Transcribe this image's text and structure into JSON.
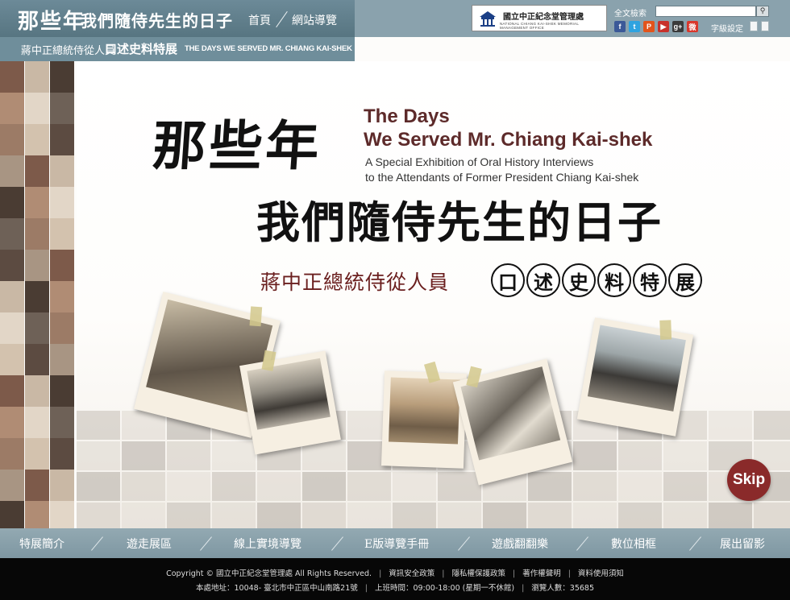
{
  "header": {
    "brand_cn": "那些年",
    "brand_cn2": "我們隨侍先生的日子",
    "nav": {
      "home": "首頁",
      "sitemap": "網站導覽"
    },
    "sub_cn": "蔣中正總統侍從人員",
    "sub_cn2": "口述史料特展",
    "sub_en": "THE DAYS WE SERVED MR. CHIANG KAI-SHEK",
    "org_name": "國立中正紀念堂管理處",
    "org_name_en": "NATIONAL CHIANG KAI-SHEK MEMORIAL MANAGEMENT OFFICE",
    "search_label": "全文檢索",
    "search_placeholder": "",
    "font_setting": "字級設定"
  },
  "social": [
    {
      "icon": "facebook-icon",
      "glyph": "f",
      "color": "#3b5998"
    },
    {
      "icon": "twitter-icon",
      "glyph": "t",
      "color": "#2fa3e0"
    },
    {
      "icon": "plurk-icon",
      "glyph": "P",
      "color": "#e2541b"
    },
    {
      "icon": "youtube-icon",
      "glyph": "▶",
      "color": "#c8312b"
    },
    {
      "icon": "google-plus-icon",
      "glyph": "g+",
      "color": "#3a3a3a"
    },
    {
      "icon": "weibo-icon",
      "glyph": "微",
      "color": "#d9362b"
    }
  ],
  "hero": {
    "title_cn_1": "那些年",
    "title_en_1": "The Days",
    "title_en_2": "We Served Mr. Chiang Kai-shek",
    "subtitle_en_1": "A Special Exhibition of Oral History Interviews",
    "subtitle_en_2": "to the Attendants of Former President Chiang Kai-shek",
    "title_cn_2": "我們隨侍先生的日子",
    "subtitle_cn": "蔣中正總統侍從人員",
    "circled": [
      "口",
      "述",
      "史",
      "料",
      "特",
      "展"
    ],
    "skip_label": "Skip"
  },
  "main_nav": [
    "特展簡介",
    "遊走展區",
    "線上實境導覽",
    "E版導覽手冊",
    "遊戲翻翻樂",
    "數位相框",
    "展出留影"
  ],
  "footer": {
    "copyright": "Copyright © 國立中正紀念堂管理處 All Rights Reserved.",
    "links": [
      "資訊安全政策",
      "隱私權保護政策",
      "著作權聲明",
      "資料使用須知"
    ],
    "address": "本處地址：10048- 臺北市中正區中山南路21號",
    "hours": "上班時間：09:00-18:00 (星期一不休館)",
    "visitors": "瀏覽人數：35685"
  }
}
